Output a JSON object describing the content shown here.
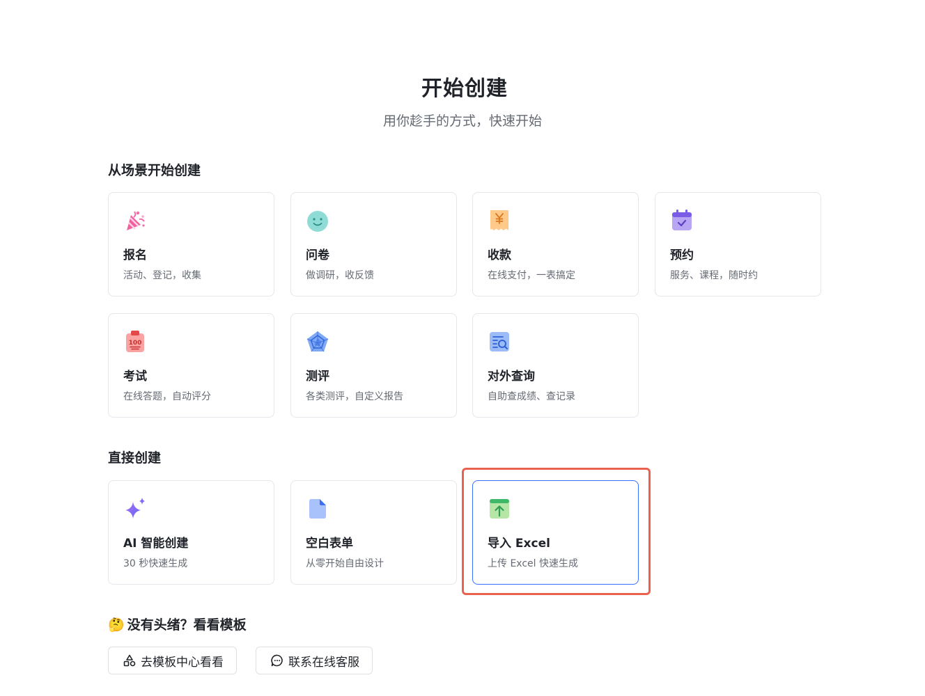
{
  "hero": {
    "title": "开始创建",
    "subtitle": "用你趁手的方式，快速开始"
  },
  "scenes": {
    "title": "从场景开始创建",
    "items": [
      {
        "label": "报名",
        "desc": "活动、登记，收集",
        "icon": "party-popper-icon"
      },
      {
        "label": "问卷",
        "desc": "做调研，收反馈",
        "icon": "smiley-face-icon"
      },
      {
        "label": "收款",
        "desc": "在线支付，一表搞定",
        "icon": "yuan-receipt-icon"
      },
      {
        "label": "预约",
        "desc": "服务、课程，随时约",
        "icon": "calendar-check-icon"
      },
      {
        "label": "考试",
        "desc": "在线答题，自动评分",
        "icon": "exam-clipboard-icon"
      },
      {
        "label": "测评",
        "desc": "各类测评，自定义报告",
        "icon": "radar-chart-icon"
      },
      {
        "label": "对外查询",
        "desc": "自助查成绩、查记录",
        "icon": "search-document-icon"
      }
    ]
  },
  "direct": {
    "title": "直接创建",
    "items": [
      {
        "label": "AI 智能创建",
        "desc": "30 秒快速生成",
        "icon": "ai-sparkle-icon"
      },
      {
        "label": "空白表单",
        "desc": "从零开始自由设计",
        "icon": "blank-file-icon"
      },
      {
        "label": "导入 Excel",
        "desc": "上传 Excel 快速生成",
        "icon": "upload-excel-icon"
      }
    ]
  },
  "templates": {
    "emoji": "🤔",
    "title": "没有头绪？看看模板",
    "template_center_label": "去模板中心看看",
    "support_label": "联系在线客服"
  },
  "colors": {
    "selected_border": "#3370ff",
    "highlight_box": "#e8624f"
  }
}
